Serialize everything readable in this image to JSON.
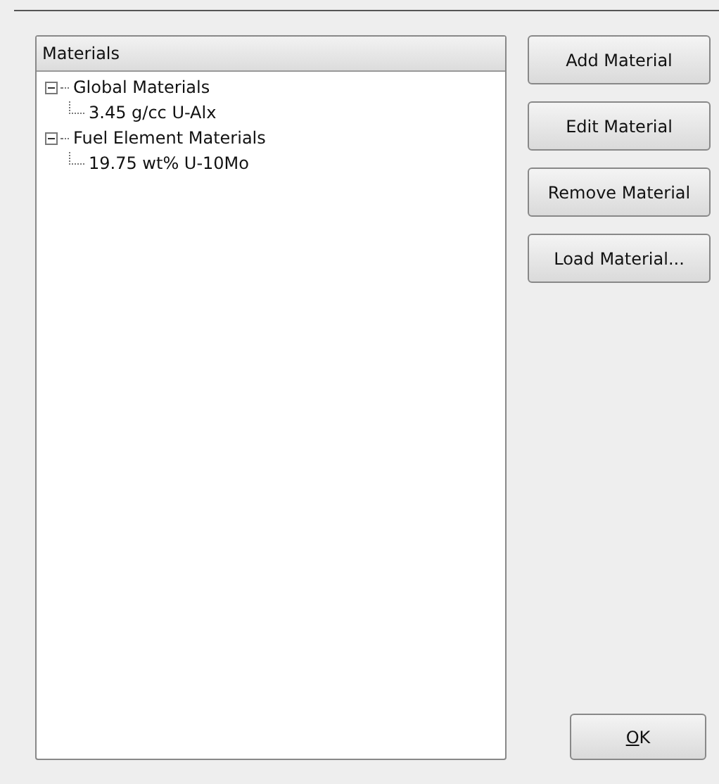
{
  "tree": {
    "header": "Materials",
    "items": [
      {
        "label": "Global Materials",
        "expanded": true,
        "children": [
          {
            "label": "3.45 g/cc U-Alx"
          }
        ]
      },
      {
        "label": "Fuel Element Materials",
        "expanded": true,
        "children": [
          {
            "label": "19.75 wt% U-10Mo"
          }
        ]
      }
    ]
  },
  "buttons": [
    {
      "label": "Add Material"
    },
    {
      "label": "Edit Material"
    },
    {
      "label": "Remove Material"
    },
    {
      "label": "Load Material..."
    }
  ],
  "ok_button": {
    "label": "OK",
    "mnemonic": true
  }
}
